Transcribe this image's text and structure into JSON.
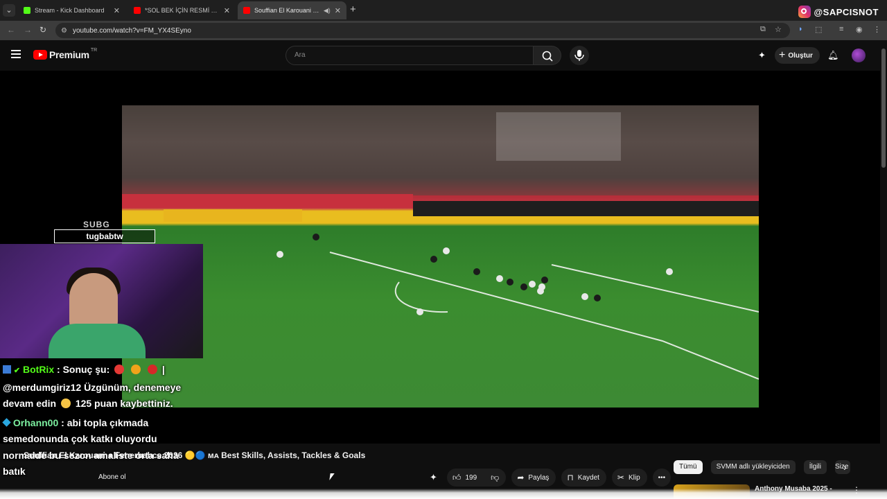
{
  "browser": {
    "tabs": [
      {
        "label": "Stream - Kick Dashboard",
        "favicon_color": "#53fc18",
        "active": false
      },
      {
        "label": "*SOL BEK İÇİN RESMİ TEKLİF YAPILDI",
        "favicon_color": "#ff0000",
        "active": false
      },
      {
        "label": "Souffian El Karouani ● Welc",
        "favicon_color": "#ff0000",
        "active": true
      }
    ],
    "url": "youtube.com/watch?v=FM_YX4SEyno",
    "instagram_handle": "@SAPCISNOT"
  },
  "youtube": {
    "logo_text": "Premium",
    "region": "TR",
    "search_placeholder": "Ara",
    "create_label": "Oluştur"
  },
  "overlay": {
    "subg_text": "SUBG",
    "subg_name": "tugbabtw",
    "chat": [
      {
        "user": "BotRix",
        "text_parts": [
          ": Sonuç şu:",
          "| @merdumgiriz12 Üzgünüm, denemeye devam edin",
          "125 puan kaybettiniz."
        ]
      },
      {
        "user": "Orhann00",
        "text": ": abi topla çıkmada semedonunda çok katkı oluyordu normalde bu sezon amaliste orta saha",
        "text_tail": "batık"
      }
    ]
  },
  "video": {
    "title": "Souffian El Karouani ● Fenerbahce 2026 🟡🔵 ᴍᴀ Best Skills, Assists, Tackles & Goals",
    "channel_sub": "Abone ol",
    "like_count": "199",
    "share_label": "Paylaş",
    "save_label": "Kaydet",
    "clip_label": "Klip"
  },
  "recommendations": {
    "chips": [
      "Tümü",
      "SVMM adlı yükleyiciden",
      "İlgili",
      "Size"
    ],
    "first_title": "Anthony Musaba 2025 -"
  },
  "colors": {
    "kick_green": "#53fc18",
    "youtube_red": "#ff0000",
    "background": "#0f0f0f"
  }
}
